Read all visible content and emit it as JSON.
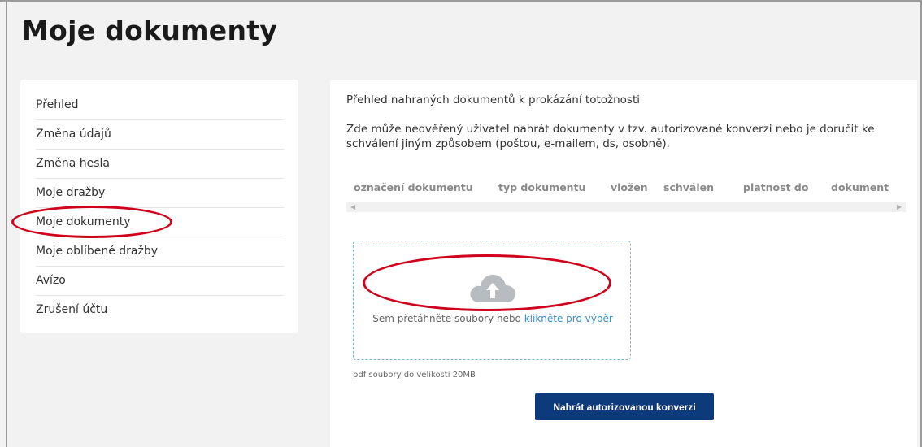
{
  "page": {
    "title": "Moje dokumenty"
  },
  "sidebar": {
    "items": [
      {
        "label": "Přehled"
      },
      {
        "label": "Změna údajů"
      },
      {
        "label": "Změna hesla"
      },
      {
        "label": "Moje dražby"
      },
      {
        "label": "Moje dokumenty"
      },
      {
        "label": "Moje oblíbené dražby"
      },
      {
        "label": "Avízo"
      },
      {
        "label": "Zrušení účtu"
      }
    ],
    "active_index": 4
  },
  "content": {
    "intro": "Přehled nahraných dokumentů k prokázání totožnosti",
    "description": "Zde může neověřený uživatel nahrát dokumenty v tzv. autorizované konverzi nebo je doručit ke schválení jiným způsobem (poštou, e-mailem, ds, osobně).",
    "table": {
      "columns": [
        "označení dokumentu",
        "typ dokumentu",
        "vložen",
        "schválen",
        "platnost do",
        "dokument"
      ],
      "rows": []
    },
    "dropzone": {
      "text": "Sem přetáhněte soubory nebo ",
      "link": "klikněte pro výběr",
      "icon": "cloud-upload-icon"
    },
    "size_hint": "pdf soubory do velikosti 20MB",
    "upload_button": "Nahrát autorizovanou konverzi"
  },
  "colors": {
    "button_bg": "#0d3a7a",
    "link": "#3b8fc7",
    "annotation": "#d0021b",
    "dropzone_border": "#7fb6c9"
  }
}
